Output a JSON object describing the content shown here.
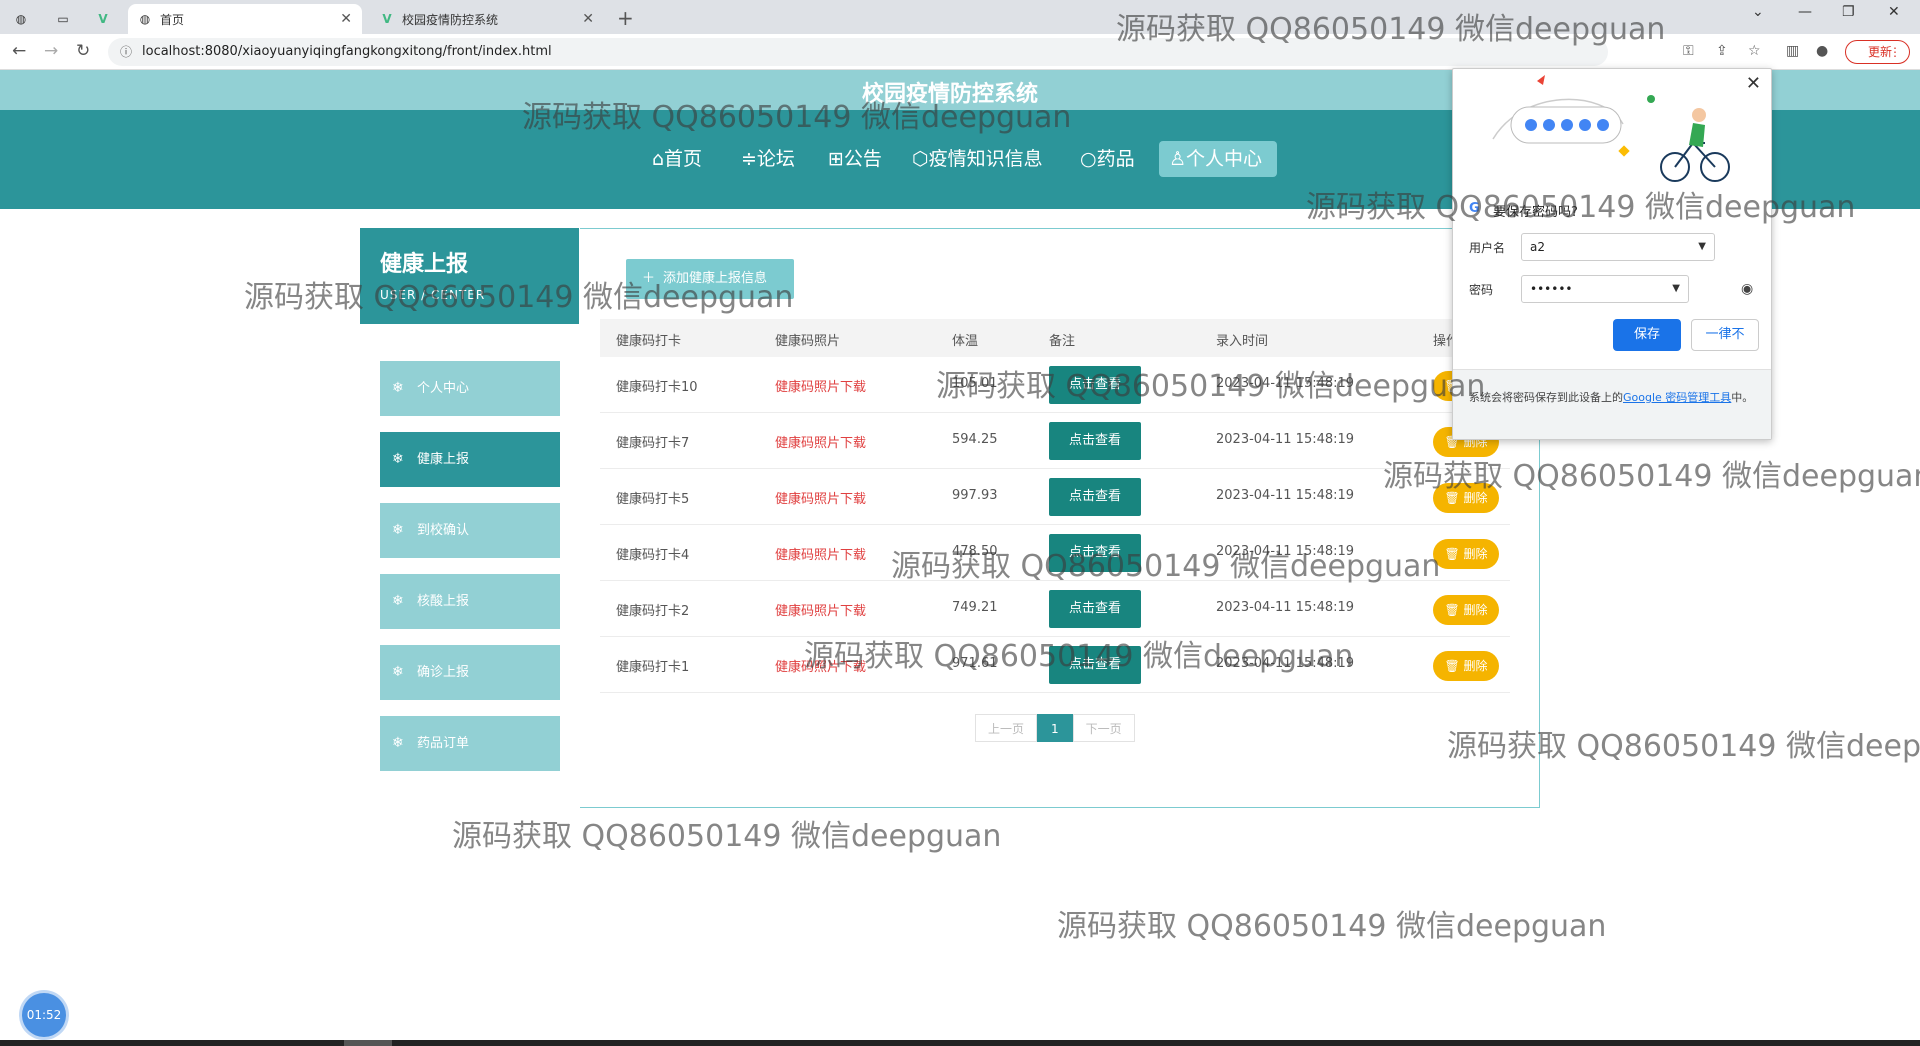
{
  "browser": {
    "tabs": [
      {
        "label": "",
        "icon": "globe-icon"
      },
      {
        "label": "",
        "icon": "page-icon"
      },
      {
        "label": "",
        "icon": "vue-icon"
      },
      {
        "label": "首页",
        "icon": "globe-icon",
        "active": true
      },
      {
        "label": "校园疫情防控系统",
        "icon": "vue-icon"
      }
    ],
    "url": "localhost:8080/xiaoyuanyiqingfangkongxitong/front/index.html",
    "update_label": "更新"
  },
  "site": {
    "title": "校园疫情防控系统",
    "nav": [
      {
        "label": "⌂首页"
      },
      {
        "label": "≑论坛"
      },
      {
        "label": "⊞公告"
      },
      {
        "label": "⬡疫情知识信息"
      },
      {
        "label": "○药品"
      },
      {
        "label": "♙个人中心",
        "active": true
      }
    ]
  },
  "sidebar": {
    "title": "健康上报",
    "subtitle": "USER / CENTER",
    "items": [
      {
        "label": "个人中心"
      },
      {
        "label": "健康上报",
        "active": true
      },
      {
        "label": "到校确认"
      },
      {
        "label": "核酸上报"
      },
      {
        "label": "确诊上报"
      },
      {
        "label": "药品订单"
      }
    ]
  },
  "content": {
    "add_button": "添加健康上报信息",
    "columns": [
      "健康码打卡",
      "健康码照片",
      "体温",
      "备注",
      "录入时间",
      "操作"
    ],
    "rows": [
      {
        "name": "健康码打卡10",
        "photo": "健康码照片下载",
        "temp": "105.01",
        "view": "点击查看",
        "time": "2023-04-11 15:48:19",
        "delete": "删除"
      },
      {
        "name": "健康码打卡7",
        "photo": "健康码照片下载",
        "temp": "594.25",
        "view": "点击查看",
        "time": "2023-04-11 15:48:19",
        "delete": "删除"
      },
      {
        "name": "健康码打卡5",
        "photo": "健康码照片下载",
        "temp": "997.93",
        "view": "点击查看",
        "time": "2023-04-11 15:48:19",
        "delete": "删除"
      },
      {
        "name": "健康码打卡4",
        "photo": "健康码照片下载",
        "temp": "478.50",
        "view": "点击查看",
        "time": "2023-04-11 15:48:19",
        "delete": "删除"
      },
      {
        "name": "健康码打卡2",
        "photo": "健康码照片下载",
        "temp": "749.21",
        "view": "点击查看",
        "time": "2023-04-11 15:48:19",
        "delete": "删除"
      },
      {
        "name": "健康码打卡1",
        "photo": "健康码照片下载",
        "temp": "971.61",
        "view": "点击查看",
        "time": "2023-04-11 15:48:19",
        "delete": "删除"
      }
    ],
    "pager": {
      "prev": "上一页",
      "current": "1",
      "next": "下一页"
    }
  },
  "password_popup": {
    "title": "要保存密码吗?",
    "username_label": "用户名",
    "username_value": "a2",
    "password_label": "密码",
    "password_value": "••••••",
    "save_label": "保存",
    "never_label": "一律不",
    "footer_text": "系统会将密码保存到此设备上的",
    "footer_link": "Google 密码管理工具",
    "footer_end": "中。"
  },
  "timer": "01:52",
  "watermark": "源码获取 QQ86050149 微信deepguan"
}
